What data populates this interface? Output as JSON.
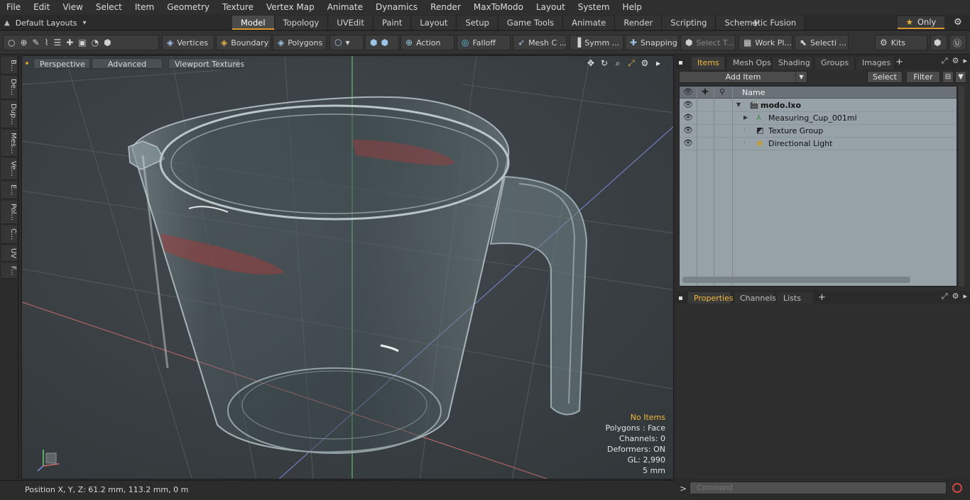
{
  "menu": [
    "File",
    "Edit",
    "View",
    "Select",
    "Item",
    "Geometry",
    "Texture",
    "Vertex Map",
    "Animate",
    "Dynamics",
    "Render",
    "MaxToModo",
    "Layout",
    "System",
    "Help"
  ],
  "layouts": {
    "label": "Default Layouts"
  },
  "tabs": [
    "Model",
    "Topology",
    "UVEdit",
    "Paint",
    "Layout",
    "Setup",
    "Game Tools",
    "Animate",
    "Render",
    "Scripting",
    "Schematic Fusion"
  ],
  "active_tab": "Model",
  "only_label": "Only",
  "toolbar": {
    "vertices": "Vertices",
    "boundary": "Boundary",
    "polygons": "Polygons",
    "action": "Action",
    "falloff": "Falloff",
    "mesh": "Mesh C ...",
    "symm": "Symm ...",
    "snapping": "Snapping",
    "select_t": "Select T...",
    "work_pl": "Work Pl...",
    "selecti": "Selecti ...",
    "kits": "Kits"
  },
  "left_tabs": [
    "B...",
    "De...",
    "Dup...",
    "Mes...",
    "Ve...",
    "E...",
    "Pol...",
    "C...",
    "UV",
    "F..."
  ],
  "viewport": {
    "perspective": "Perspective",
    "advanced": "Advanced",
    "viewport_textures": "Viewport Textures",
    "info": {
      "no_items": "No Items",
      "polygons": "Polygons : Face",
      "channels": "Channels: 0",
      "deformers": "Deformers: ON",
      "gl": "GL: 2,990",
      "scale": "5 mm"
    }
  },
  "status": {
    "position": "Position X, Y, Z:   61.2 mm, 113.2 mm, 0 m"
  },
  "items_panel": {
    "tabs": [
      "Items",
      "Mesh Ops",
      "Shading",
      "Groups",
      "Images"
    ],
    "add_item": "Add Item",
    "select": "Select",
    "filter": "Filter",
    "col_name": "Name",
    "rows": [
      {
        "label": "modo.lxo"
      },
      {
        "label": "Measuring_Cup_001ml"
      },
      {
        "label": "Texture Group"
      },
      {
        "label": "Directional Light"
      }
    ]
  },
  "properties_panel": {
    "tabs": [
      "Properties",
      "Channels",
      "Lists"
    ]
  },
  "command": {
    "placeholder": "Command"
  },
  "colors": {
    "accent": "#d89a2b",
    "info_warn": "#f2b83a",
    "list_bg": "#97a1a8"
  }
}
